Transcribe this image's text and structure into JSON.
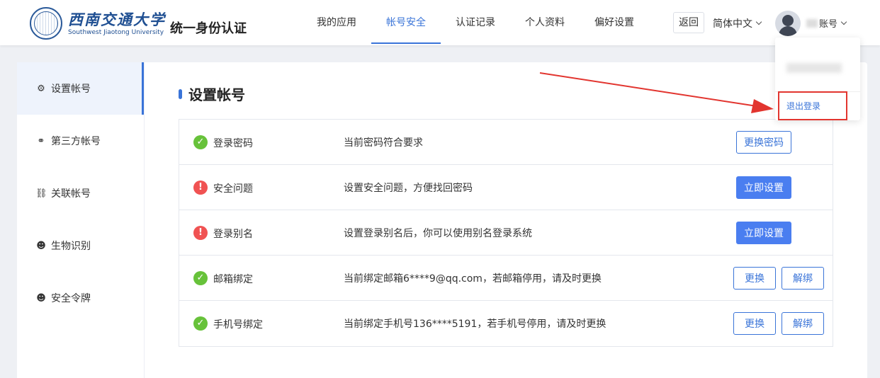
{
  "header": {
    "logo_cn": "西南交通大学",
    "logo_en": "Southwest Jiaotong University",
    "system_title": "统一身份认证",
    "nav": [
      {
        "label": "我的应用",
        "active": false
      },
      {
        "label": "帐号安全",
        "active": true
      },
      {
        "label": "认证记录",
        "active": false
      },
      {
        "label": "个人资料",
        "active": false
      },
      {
        "label": "偏好设置",
        "active": false
      }
    ],
    "back_label": "返回",
    "language": "简体中文",
    "user_label": "账号"
  },
  "dropdown": {
    "logout_label": "退出登录"
  },
  "sidebar": {
    "items": [
      {
        "label": "设置帐号",
        "icon": "gear-icon",
        "active": true
      },
      {
        "label": "第三方帐号",
        "icon": "link-icon",
        "active": false
      },
      {
        "label": "关联帐号",
        "icon": "chain-icon",
        "active": false
      },
      {
        "label": "生物识别",
        "icon": "user-icon",
        "active": false
      },
      {
        "label": "安全令牌",
        "icon": "user-icon",
        "active": false
      }
    ]
  },
  "main": {
    "title": "设置帐号",
    "rows": [
      {
        "status": "ok",
        "name": "登录密码",
        "desc": "当前密码符合要求",
        "buttons": [
          "更换密码"
        ]
      },
      {
        "status": "warn",
        "name": "安全问题",
        "desc": "设置安全问题，方便找回密码",
        "buttons": [
          "立即设置"
        ]
      },
      {
        "status": "warn",
        "name": "登录别名",
        "desc": "设置登录别名后，你可以使用别名登录系统",
        "buttons": [
          "立即设置"
        ]
      },
      {
        "status": "ok",
        "name": "邮箱绑定",
        "desc": "当前绑定邮箱6****9@qq.com，若邮箱停用，请及时更换",
        "buttons": [
          "更换",
          "解绑"
        ]
      },
      {
        "status": "ok",
        "name": "手机号绑定",
        "desc": "当前绑定手机号136****5191，若手机号停用，请及时更换",
        "buttons": [
          "更换",
          "解绑"
        ]
      }
    ]
  },
  "colors": {
    "accent": "#3a74d8",
    "success": "#67c23a",
    "warning": "#f05252",
    "annotation": "#e2352f"
  }
}
